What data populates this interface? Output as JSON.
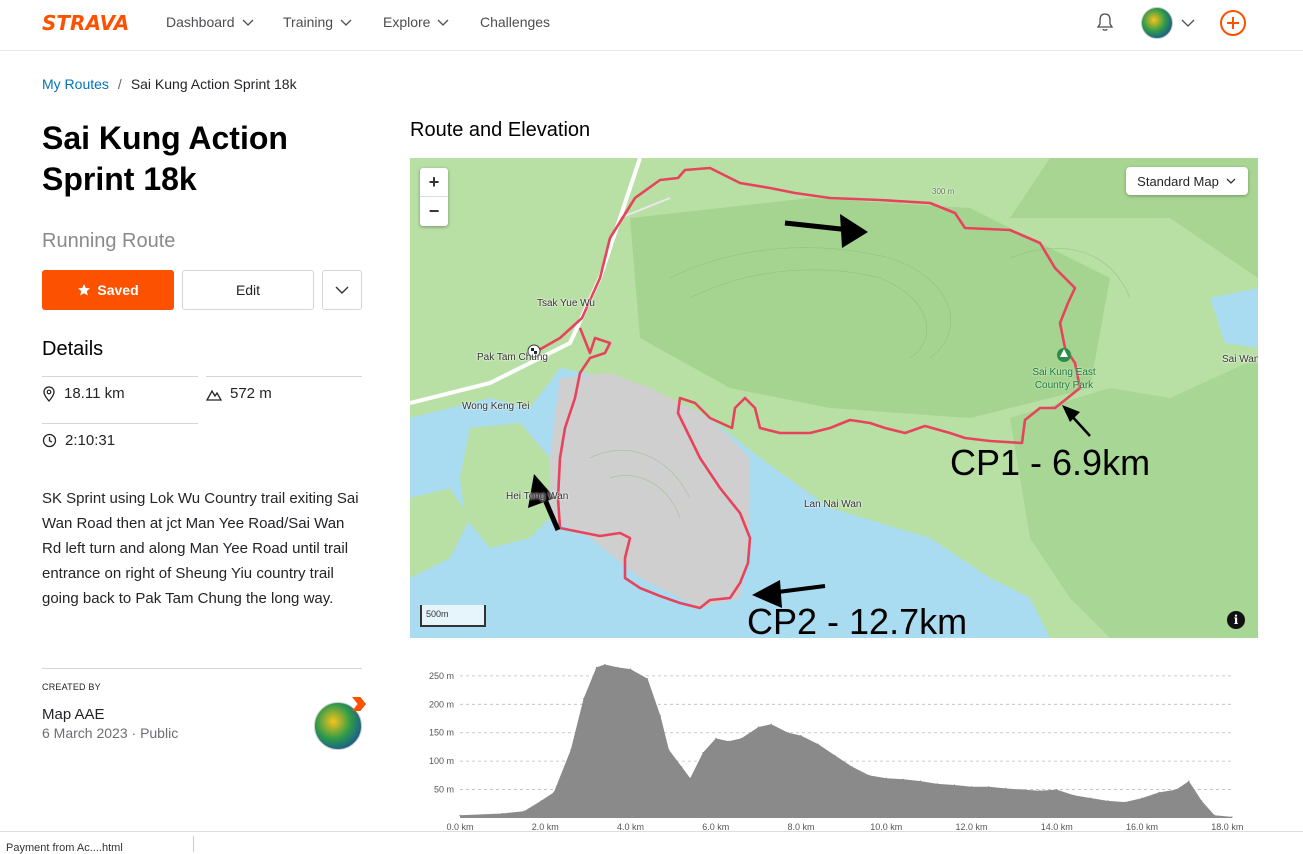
{
  "brand": {
    "logo": "STRAVA",
    "accent": "#fc5200"
  },
  "nav": {
    "items": [
      {
        "label": "Dashboard"
      },
      {
        "label": "Training"
      },
      {
        "label": "Explore"
      },
      {
        "label": "Challenges"
      }
    ]
  },
  "breadcrumb": {
    "parent": "My Routes",
    "separator": "/",
    "current": "Sai Kung Action Sprint 18k"
  },
  "route": {
    "title": "Sai Kung Action Sprint 18k",
    "type": "Running Route",
    "saved_label": "Saved",
    "edit_label": "Edit"
  },
  "details": {
    "heading": "Details",
    "distance": "18.11 km",
    "elevation": "572 m",
    "time": "2:10:31",
    "description": "SK Sprint using Lok Wu Country trail exiting Sai Wan Road then at jct Man Yee Road/Sai Wan Rd left turn and along Man Yee Road until trail entrance on right of Sheung Yiu country trail going back to Pak Tam Chung the long way."
  },
  "creator": {
    "label": "CREATED BY",
    "name": "Map AAE",
    "date": "6 March 2023",
    "visibility": "Public"
  },
  "map_section": {
    "heading": "Route and Elevation",
    "map_type": "Standard Map",
    "scale": "500m",
    "places": [
      "Tsak Yue Wu",
      "Pak Tam Chung",
      "Wong Keng Tei",
      "Hei Tong Wan",
      "Lan Nai Wan",
      "Sai Wan"
    ],
    "park": "Sai Kung East Country Park",
    "contour_300": "300 m",
    "annotations": {
      "cp1": "CP1 - 6.9km",
      "cp2": "CP2 - 12.7km"
    },
    "route_color": "#e8435c"
  },
  "chart_data": {
    "type": "area",
    "x_label_unit": "km",
    "x_ticks": [
      "0.0 km",
      "2.0 km",
      "4.0 km",
      "6.0 km",
      "8.0 km",
      "10.0 km",
      "12.0 km",
      "14.0 km",
      "16.0 km",
      "18.0 km"
    ],
    "y_ticks": [
      "50 m",
      "100 m",
      "150 m",
      "200 m",
      "250 m"
    ],
    "ylim": [
      0,
      285
    ],
    "xlim": [
      0,
      18.11
    ],
    "x": [
      0,
      1,
      1.5,
      1.9,
      2.2,
      2.6,
      2.9,
      3.2,
      3.4,
      3.7,
      4.0,
      4.4,
      4.7,
      4.9,
      5.2,
      5.4,
      5.7,
      6.0,
      6.3,
      6.6,
      7.0,
      7.3,
      7.7,
      8.0,
      8.4,
      8.8,
      9.2,
      9.6,
      10.0,
      10.4,
      10.8,
      11.2,
      11.6,
      12.0,
      12.4,
      12.8,
      13.2,
      13.6,
      14.0,
      14.4,
      14.8,
      15.2,
      15.6,
      16.0,
      16.4,
      16.8,
      17.1,
      17.4,
      17.7,
      18.11
    ],
    "y": [
      5,
      8,
      12,
      30,
      45,
      120,
      210,
      265,
      270,
      265,
      262,
      245,
      180,
      120,
      90,
      70,
      115,
      140,
      135,
      140,
      160,
      165,
      150,
      145,
      130,
      110,
      90,
      75,
      70,
      68,
      65,
      60,
      58,
      55,
      55,
      52,
      50,
      48,
      50,
      40,
      35,
      30,
      28,
      35,
      45,
      50,
      65,
      30,
      5,
      2
    ],
    "fill": "#8a8a8a"
  },
  "bottom": {
    "download": "Payment from Ac....html"
  }
}
